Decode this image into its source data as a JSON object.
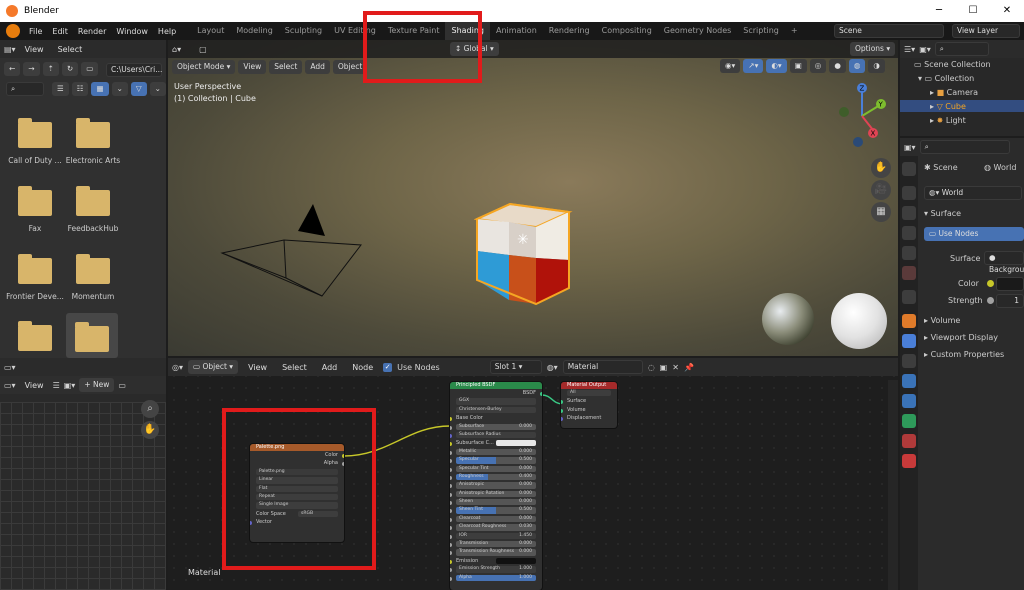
{
  "app": {
    "title": "Blender"
  },
  "menus": [
    "File",
    "Edit",
    "Render",
    "Window",
    "Help"
  ],
  "workspace_tabs": [
    "Layout",
    "Modeling",
    "Sculpting",
    "UV Editing",
    "Texture Paint",
    "Shading",
    "Animation",
    "Rendering",
    "Compositing",
    "Geometry Nodes",
    "Scripting"
  ],
  "active_tab": "Shading",
  "scene": {
    "name": "Scene",
    "view_layer": "View Layer"
  },
  "file_browser": {
    "menu": [
      "View",
      "Select"
    ],
    "path": "C:\\Users\\Cri...",
    "folders": [
      "Call of Duty ...",
      "Electronic Arts",
      "Fax",
      "FeedbackHub",
      "Frontier Deve...",
      "Momentum",
      "",
      ""
    ]
  },
  "viewport": {
    "mode": "Object Mode",
    "menu": [
      "View",
      "Select",
      "Add",
      "Object"
    ],
    "transform": "Global",
    "options": "Options",
    "info_line1": "User Perspective",
    "info_line2": "(1) Collection | Cube"
  },
  "outliner": {
    "root": "Scene Collection",
    "collection": "Collection",
    "items": [
      "Camera",
      "Cube",
      "Light"
    ]
  },
  "properties": {
    "scene_label": "Scene",
    "world_label": "World",
    "world_name": "World",
    "surface_header": "Surface",
    "use_nodes": "Use Nodes",
    "surface_label": "Surface",
    "surface_value": "Background",
    "color_label": "Color",
    "strength_label": "Strength",
    "strength_value": "1",
    "collapsed": [
      "Volume",
      "Viewport Display",
      "Custom Properties"
    ]
  },
  "image_editor": {
    "view": "View",
    "new": "New"
  },
  "node_editor": {
    "type": "Object",
    "menu": [
      "View",
      "Select",
      "Add",
      "Node"
    ],
    "use_nodes": "Use Nodes",
    "slot": "Slot 1",
    "material": "Material",
    "frame_label": "Material"
  },
  "image_node": {
    "title": "Palette.png",
    "outputs": [
      "Color",
      "Alpha"
    ],
    "image": "Palette.png",
    "fields": [
      "Linear",
      "Flat",
      "Repeat",
      "Single Image"
    ],
    "color_space_label": "Color Space",
    "color_space": "sRGB",
    "vector": "Vector"
  },
  "bsdf_node": {
    "title": "Principled BSDF",
    "output": "BSDF",
    "dists": [
      "GGX",
      "Christensen-Burley"
    ],
    "rows": [
      {
        "label": "Base Color",
        "value": ""
      },
      {
        "label": "Subsurface",
        "value": "0.000"
      },
      {
        "label": "Subsurface Radius",
        "value": ""
      },
      {
        "label": "Subsurface C...",
        "value": ""
      },
      {
        "label": "Metallic",
        "value": "0.000"
      },
      {
        "label": "Specular",
        "value": "0.500"
      },
      {
        "label": "Specular Tint",
        "value": "0.000"
      },
      {
        "label": "Roughness",
        "value": "0.400"
      },
      {
        "label": "Anisotropic",
        "value": "0.000"
      },
      {
        "label": "Anisotropic Rotation",
        "value": "0.000"
      },
      {
        "label": "Sheen",
        "value": "0.000"
      },
      {
        "label": "Sheen Tint",
        "value": "0.500"
      },
      {
        "label": "Clearcoat",
        "value": "0.000"
      },
      {
        "label": "Clearcoat Roughness",
        "value": "0.030"
      },
      {
        "label": "IOR",
        "value": "1.450"
      },
      {
        "label": "Transmission",
        "value": "0.000"
      },
      {
        "label": "Transmission Roughness",
        "value": "0.000"
      },
      {
        "label": "Emission",
        "value": ""
      },
      {
        "label": "Emission Strength",
        "value": "1.000"
      },
      {
        "label": "Alpha",
        "value": "1.000"
      }
    ]
  },
  "output_node": {
    "title": "Material Output",
    "target": "All",
    "inputs": [
      "Surface",
      "Volume",
      "Displacement"
    ]
  },
  "colors": {
    "accent": "#4772b3",
    "highlight": "#e11b1b",
    "active_object": "#f5a623"
  }
}
